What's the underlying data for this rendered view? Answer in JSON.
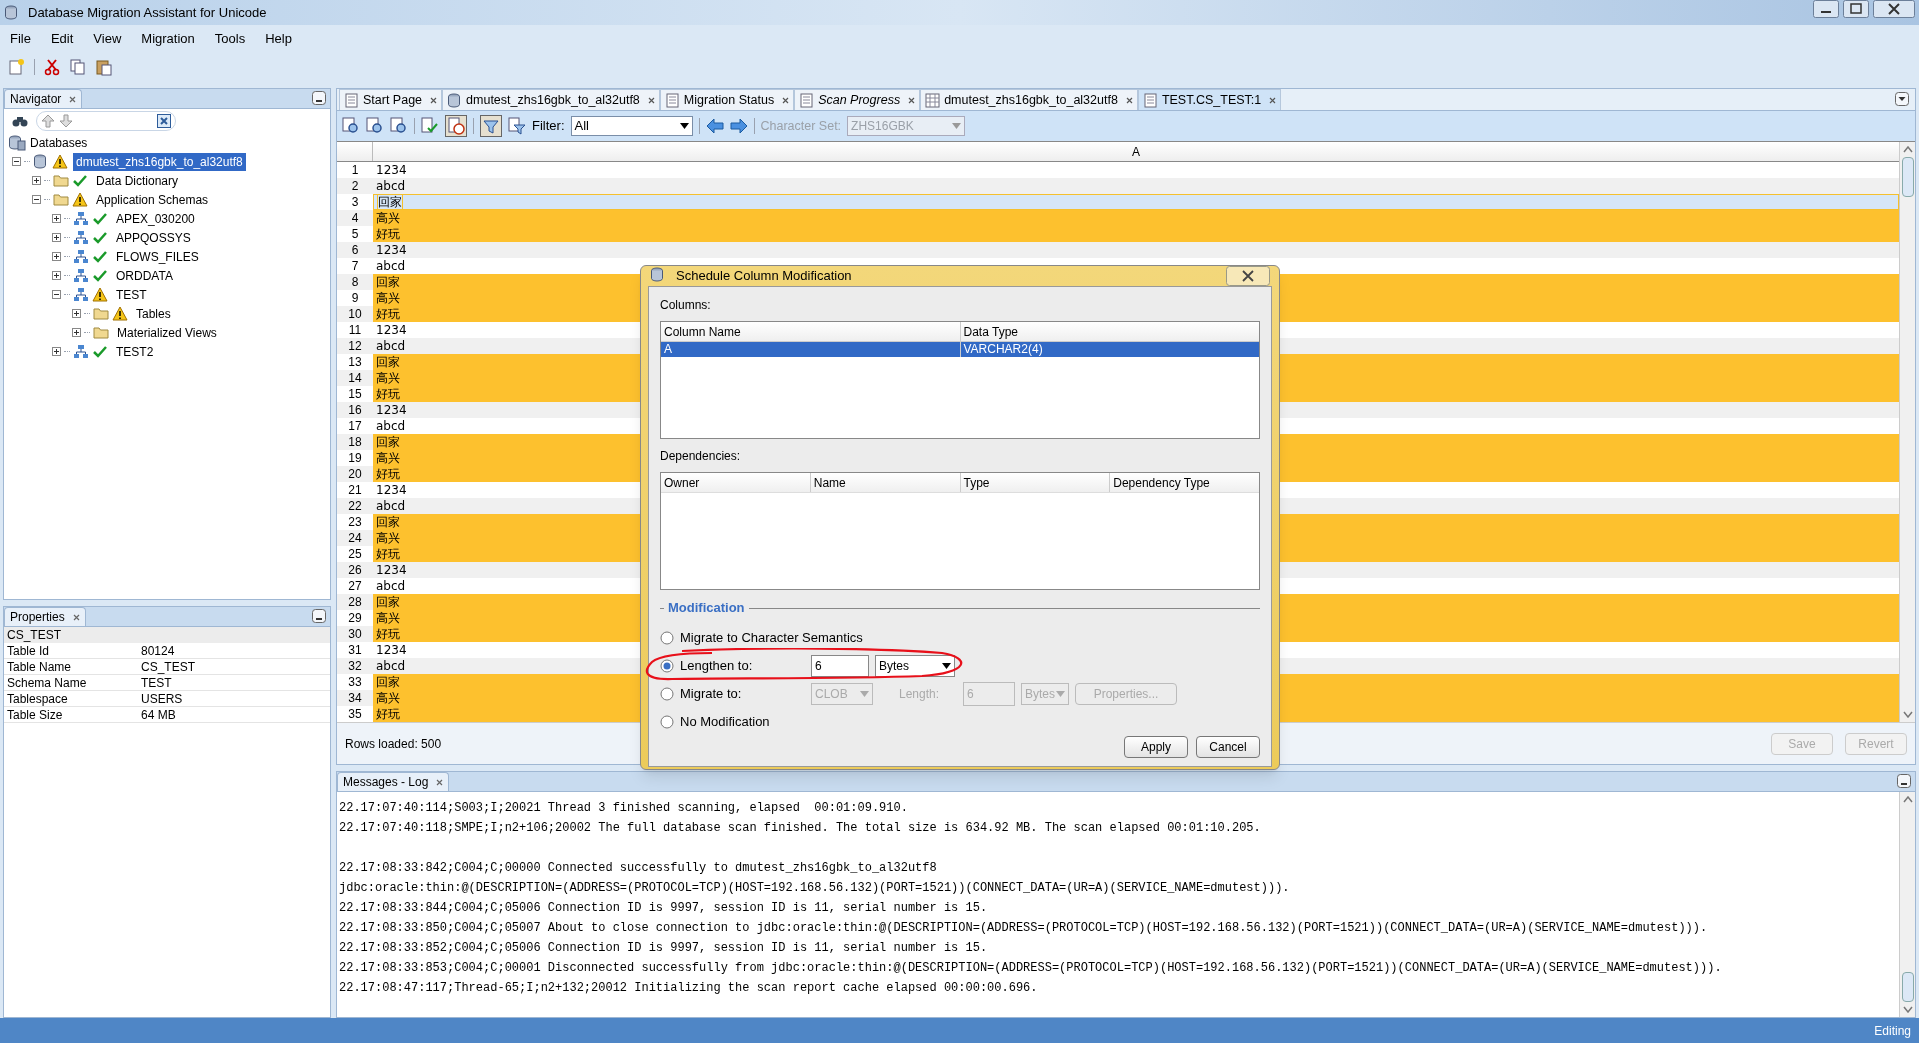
{
  "window": {
    "title": "Database Migration Assistant for Unicode"
  },
  "menu": [
    "File",
    "Edit",
    "View",
    "Migration",
    "Tools",
    "Help"
  ],
  "navigator": {
    "title": "Navigator",
    "root_label": "Databases",
    "tree": [
      {
        "label": "dmutest_zhs16gbk_to_al32utf8",
        "kind": "database",
        "warning": true,
        "ok": false,
        "expanded": true,
        "selected": true,
        "children": [
          {
            "label": "Data Dictionary",
            "kind": "folder",
            "warning": false,
            "ok": true,
            "expanded": false,
            "selected": false
          },
          {
            "label": "Application Schemas",
            "kind": "folder",
            "warning": true,
            "ok": false,
            "expanded": true,
            "selected": false,
            "children": [
              {
                "label": "APEX_030200",
                "kind": "schema",
                "warning": false,
                "ok": true,
                "expanded": false,
                "selected": false
              },
              {
                "label": "APPQOSSYS",
                "kind": "schema",
                "warning": false,
                "ok": true,
                "expanded": false,
                "selected": false
              },
              {
                "label": "FLOWS_FILES",
                "kind": "schema",
                "warning": false,
                "ok": true,
                "expanded": false,
                "selected": false
              },
              {
                "label": "ORDDATA",
                "kind": "schema",
                "warning": false,
                "ok": true,
                "expanded": false,
                "selected": false
              },
              {
                "label": "TEST",
                "kind": "schema",
                "warning": true,
                "ok": false,
                "expanded": true,
                "selected": false,
                "children": [
                  {
                    "label": "Tables",
                    "kind": "folder",
                    "warning": true,
                    "ok": false,
                    "expanded": false,
                    "selected": false
                  },
                  {
                    "label": "Materialized Views",
                    "kind": "folder",
                    "warning": false,
                    "ok": false,
                    "expanded": false,
                    "selected": false
                  }
                ]
              },
              {
                "label": "TEST2",
                "kind": "schema",
                "warning": false,
                "ok": true,
                "expanded": false,
                "selected": false
              }
            ]
          }
        ]
      }
    ]
  },
  "properties": {
    "title": "Properties",
    "header": "CS_TEST",
    "rows": [
      {
        "name": "Table Id",
        "value": "80124"
      },
      {
        "name": "Table Name",
        "value": "CS_TEST"
      },
      {
        "name": "Schema Name",
        "value": "TEST"
      },
      {
        "name": "Tablespace",
        "value": "USERS"
      },
      {
        "name": "Table Size",
        "value": "64 MB"
      }
    ]
  },
  "tabs": [
    {
      "label": "Start Page",
      "kind": "page",
      "italic": false,
      "selected": false
    },
    {
      "label": "dmutest_zhs16gbk_to_al32utf8",
      "kind": "database",
      "italic": false,
      "selected": false
    },
    {
      "label": "Migration Status",
      "kind": "page",
      "italic": false,
      "selected": false
    },
    {
      "label": "Scan Progress",
      "kind": "page",
      "italic": true,
      "selected": false
    },
    {
      "label": "dmutest_zhs16gbk_to_al32utf8",
      "kind": "grid",
      "italic": false,
      "selected": false
    },
    {
      "label": "TEST.CS_TEST:1",
      "kind": "page",
      "italic": false,
      "selected": true
    }
  ],
  "toolbar": {
    "filter_label": "Filter:",
    "filter_value": "All",
    "charset_label": "Character Set:",
    "charset_value": "ZHS16GBK",
    "charset_disabled": true
  },
  "grid": {
    "column": "A",
    "rows": [
      {
        "n": "1",
        "value": "1234",
        "highlighted": false,
        "selected": false
      },
      {
        "n": "2",
        "value": "abcd",
        "highlighted": false,
        "selected": false
      },
      {
        "n": "3",
        "value": "回家",
        "highlighted": true,
        "selected": true
      },
      {
        "n": "4",
        "value": "高兴",
        "highlighted": true,
        "selected": false
      },
      {
        "n": "5",
        "value": "好玩",
        "highlighted": true,
        "selected": false
      },
      {
        "n": "6",
        "value": "1234",
        "highlighted": false,
        "selected": false
      },
      {
        "n": "7",
        "value": "abcd",
        "highlighted": false,
        "selected": false
      },
      {
        "n": "8",
        "value": "回家",
        "highlighted": true,
        "selected": false
      },
      {
        "n": "9",
        "value": "高兴",
        "highlighted": true,
        "selected": false
      },
      {
        "n": "10",
        "value": "好玩",
        "highlighted": true,
        "selected": false
      },
      {
        "n": "11",
        "value": "1234",
        "highlighted": false,
        "selected": false
      },
      {
        "n": "12",
        "value": "abcd",
        "highlighted": false,
        "selected": false
      },
      {
        "n": "13",
        "value": "回家",
        "highlighted": true,
        "selected": false
      },
      {
        "n": "14",
        "value": "高兴",
        "highlighted": true,
        "selected": false
      },
      {
        "n": "15",
        "value": "好玩",
        "highlighted": true,
        "selected": false
      },
      {
        "n": "16",
        "value": "1234",
        "highlighted": false,
        "selected": false
      },
      {
        "n": "17",
        "value": "abcd",
        "highlighted": false,
        "selected": false
      },
      {
        "n": "18",
        "value": "回家",
        "highlighted": true,
        "selected": false
      },
      {
        "n": "19",
        "value": "高兴",
        "highlighted": true,
        "selected": false
      },
      {
        "n": "20",
        "value": "好玩",
        "highlighted": true,
        "selected": false
      },
      {
        "n": "21",
        "value": "1234",
        "highlighted": false,
        "selected": false
      },
      {
        "n": "22",
        "value": "abcd",
        "highlighted": false,
        "selected": false
      },
      {
        "n": "23",
        "value": "回家",
        "highlighted": true,
        "selected": false
      },
      {
        "n": "24",
        "value": "高兴",
        "highlighted": true,
        "selected": false
      },
      {
        "n": "25",
        "value": "好玩",
        "highlighted": true,
        "selected": false
      },
      {
        "n": "26",
        "value": "1234",
        "highlighted": false,
        "selected": false
      },
      {
        "n": "27",
        "value": "abcd",
        "highlighted": false,
        "selected": false
      },
      {
        "n": "28",
        "value": "回家",
        "highlighted": true,
        "selected": false
      },
      {
        "n": "29",
        "value": "高兴",
        "highlighted": true,
        "selected": false
      },
      {
        "n": "30",
        "value": "好玩",
        "highlighted": true,
        "selected": false
      },
      {
        "n": "31",
        "value": "1234",
        "highlighted": false,
        "selected": false
      },
      {
        "n": "32",
        "value": "abcd",
        "highlighted": false,
        "selected": false
      },
      {
        "n": "33",
        "value": "回家",
        "highlighted": true,
        "selected": false
      },
      {
        "n": "34",
        "value": "高兴",
        "highlighted": true,
        "selected": false
      },
      {
        "n": "35",
        "value": "好玩",
        "highlighted": true,
        "selected": false
      }
    ],
    "rows_loaded": "Rows loaded: 500",
    "buttons": [
      {
        "label": "Save",
        "disabled": true
      },
      {
        "label": "Revert",
        "disabled": true
      }
    ]
  },
  "messages": {
    "title": "Messages - Log",
    "lines": [
      {
        "text": "22.17:07:40:114;S003;I;20021 Thread 3 finished scanning, elapsed  00:01:09.910.",
        "gap_before": false
      },
      {
        "text": "22.17:07:40:118;SMPE;I;n2+106;20002 The full database scan finished. The total size is 634.92 MB. The scan elapsed 00:01:10.205.",
        "gap_before": false
      },
      {
        "text": "22.17:08:33:842;C004;C;00000 Connected successfully to dmutest_zhs16gbk_to_al32utf8",
        "gap_before": true
      },
      {
        "text": "jdbc:oracle:thin:@(DESCRIPTION=(ADDRESS=(PROTOCOL=TCP)(HOST=192.168.56.132)(PORT=1521))(CONNECT_DATA=(UR=A)(SERVICE_NAME=dmutest))).",
        "gap_before": false
      },
      {
        "text": "22.17:08:33:844;C004;C;05006 Connection ID is 9997, session ID is 11, serial number is 15.",
        "gap_before": false
      },
      {
        "text": "22.17:08:33:850;C004;C;05007 About to close connection to jdbc:oracle:thin:@(DESCRIPTION=(ADDRESS=(PROTOCOL=TCP)(HOST=192.168.56.132)(PORT=1521))(CONNECT_DATA=(UR=A)(SERVICE_NAME=dmutest))).",
        "gap_before": false
      },
      {
        "text": "22.17:08:33:852;C004;C;05006 Connection ID is 9997, session ID is 11, serial number is 15.",
        "gap_before": false
      },
      {
        "text": "22.17:08:33:853;C004;C;00001 Disconnected successfully from jdbc:oracle:thin:@(DESCRIPTION=(ADDRESS=(PROTOCOL=TCP)(HOST=192.168.56.132)(PORT=1521))(CONNECT_DATA=(UR=A)(SERVICE_NAME=dmutest))).",
        "gap_before": false
      },
      {
        "text": "22.17:08:47:117;Thread-65;I;n2+132;20012 Initializing the scan report cache elapsed 00:00:00.696.",
        "gap_before": false
      }
    ]
  },
  "status_bar": {
    "text": "Editing"
  },
  "dialog": {
    "title": "Schedule Column Modification",
    "columns_label": "Columns:",
    "columns_table": {
      "columns": [
        "Column Name",
        "Data Type"
      ],
      "rows": [
        {
          "cells": [
            "A",
            "VARCHAR2(4)"
          ],
          "selected": true
        }
      ]
    },
    "dependencies_label": "Dependencies:",
    "dependencies_table": {
      "columns": [
        "Owner",
        "Name",
        "Type",
        "Dependency Type"
      ]
    },
    "modification_label": "Modification",
    "options": [
      {
        "kind": "plain",
        "label": "Migrate to Character Semantics",
        "selected": false
      },
      {
        "kind": "length",
        "label": "Lengthen to:",
        "selected": true,
        "value": "6",
        "unit": "Bytes"
      },
      {
        "kind": "migrate",
        "label": "Migrate to:",
        "selected": false,
        "type": "CLOB",
        "length_label": "Length:",
        "length": "6",
        "unit": "Bytes",
        "properties": "Properties..."
      },
      {
        "kind": "plain",
        "label": "No Modification",
        "selected": false
      }
    ],
    "buttons": [
      "Apply",
      "Cancel"
    ]
  }
}
